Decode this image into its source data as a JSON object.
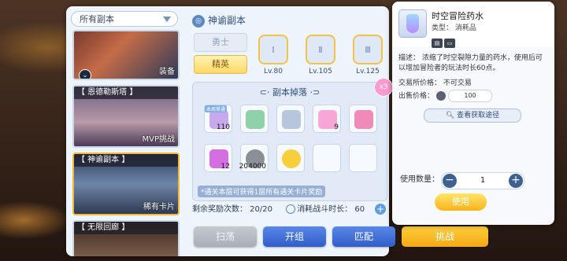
{
  "filter": {
    "label": "所有副本"
  },
  "dungeons": [
    {
      "title": "",
      "tag": "装备"
    },
    {
      "title": "【 恩德勒斯塔 】",
      "tag": "MVP挑战"
    },
    {
      "title": "【 神谕副本 】",
      "tag": "稀有卡片"
    },
    {
      "title": "【 无限回廊 】",
      "tag": ""
    }
  ],
  "header": {
    "title": "神谕副本"
  },
  "difficulty": {
    "normal": "勇士",
    "elite": "精英"
  },
  "levels": [
    {
      "roman": "Ⅰ",
      "label": "Lv.80"
    },
    {
      "roman": "Ⅱ",
      "label": "Lv.105"
    },
    {
      "roman": "Ⅲ",
      "label": "Lv.125"
    }
  ],
  "drops": {
    "title": "副本掉落",
    "multiplier": "x3",
    "mini_tag": "本周首通",
    "items": [
      {
        "count": "110",
        "color": "#c9a9ee"
      },
      {
        "count": "",
        "color": "#8fd1a9"
      },
      {
        "count": "",
        "color": "#b8c6dc"
      },
      {
        "count": "9",
        "color": "#f7a7d6"
      },
      {
        "count": "",
        "color": "#f08bb8"
      },
      {
        "count": "12",
        "color": "#d36fe0"
      },
      {
        "count": "204000",
        "color": "#8a8f98"
      },
      {
        "count": "",
        "color": "#f6cf3a"
      },
      {
        "count": "",
        "color": ""
      },
      {
        "count": "",
        "color": ""
      }
    ],
    "note": "*通关本层可获得1层所有通关卡片奖励"
  },
  "stats": {
    "remaining": "剩余奖励次数： 20/20",
    "battle": "消耗战斗时长：  60"
  },
  "buttons": {
    "sweep": "扫荡",
    "team": "开组",
    "match": "匹配",
    "challenge": "挑战"
  },
  "item": {
    "name": "时空冒险药水",
    "type": "类型： 消耗品",
    "description": "描述： 浓缩了时空裂隙力量的药水，使用后可以增加冒险者的玩法时长60点。",
    "trade": "交易所价格：  不可交易",
    "sell_label": "出售价格：",
    "sell_price": "100",
    "route_button": "查看获取途径",
    "qty_label": "使用数量：",
    "qty_value": "1",
    "use_button": "使用"
  }
}
